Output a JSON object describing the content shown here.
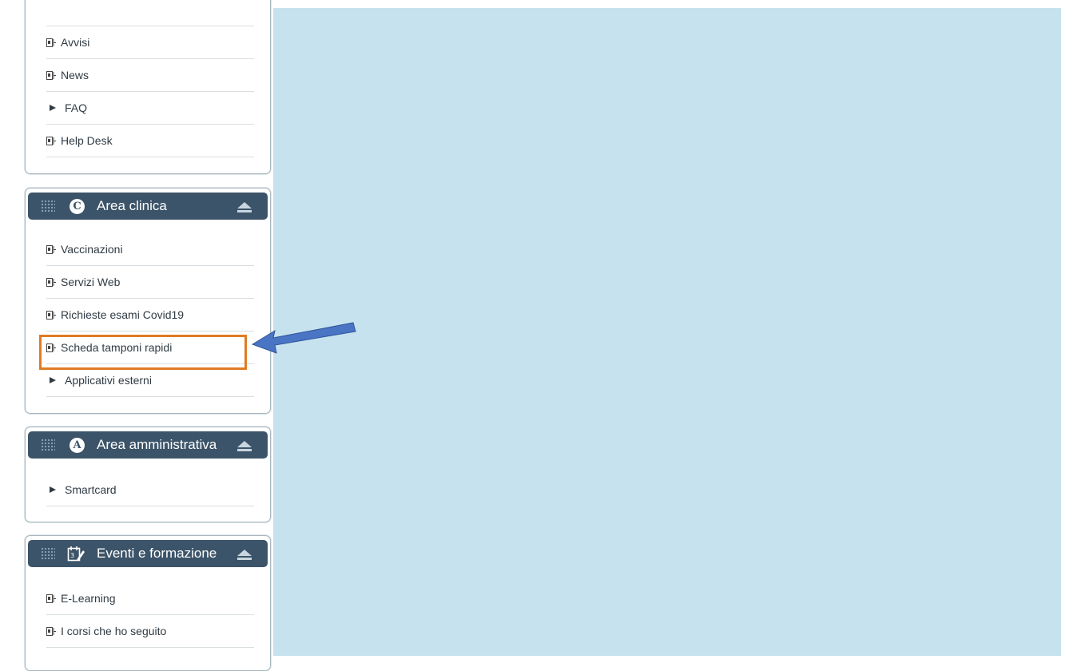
{
  "colors": {
    "content_bg": "#c6e2ee",
    "panel_header": "#3c5469",
    "highlight": "#e07b24",
    "arrow": "#4a74c4"
  },
  "panel_top": {
    "items": [
      {
        "label": "Avvisi",
        "icon": "page-icon"
      },
      {
        "label": "News",
        "icon": "page-icon"
      },
      {
        "label": "FAQ",
        "icon": "triangle-right-icon"
      },
      {
        "label": "Help Desk",
        "icon": "page-icon"
      }
    ]
  },
  "panel_clinica": {
    "badge": "C",
    "title": "Area clinica",
    "items": [
      {
        "label": "Vaccinazioni",
        "icon": "page-icon"
      },
      {
        "label": "Servizi Web",
        "icon": "page-icon"
      },
      {
        "label": "Richieste esami Covid19",
        "icon": "page-icon"
      },
      {
        "label": "Scheda tamponi rapidi",
        "icon": "page-icon"
      },
      {
        "label": "Applicativi esterni",
        "icon": "triangle-right-icon"
      }
    ]
  },
  "panel_amministrativa": {
    "badge": "A",
    "title": "Area amministrativa",
    "items": [
      {
        "label": "Smartcard",
        "icon": "triangle-right-icon"
      }
    ]
  },
  "panel_eventi": {
    "title": "Eventi e formazione",
    "items": [
      {
        "label": "E-Learning",
        "icon": "page-icon"
      },
      {
        "label": "I corsi che ho seguito",
        "icon": "page-icon"
      }
    ]
  }
}
